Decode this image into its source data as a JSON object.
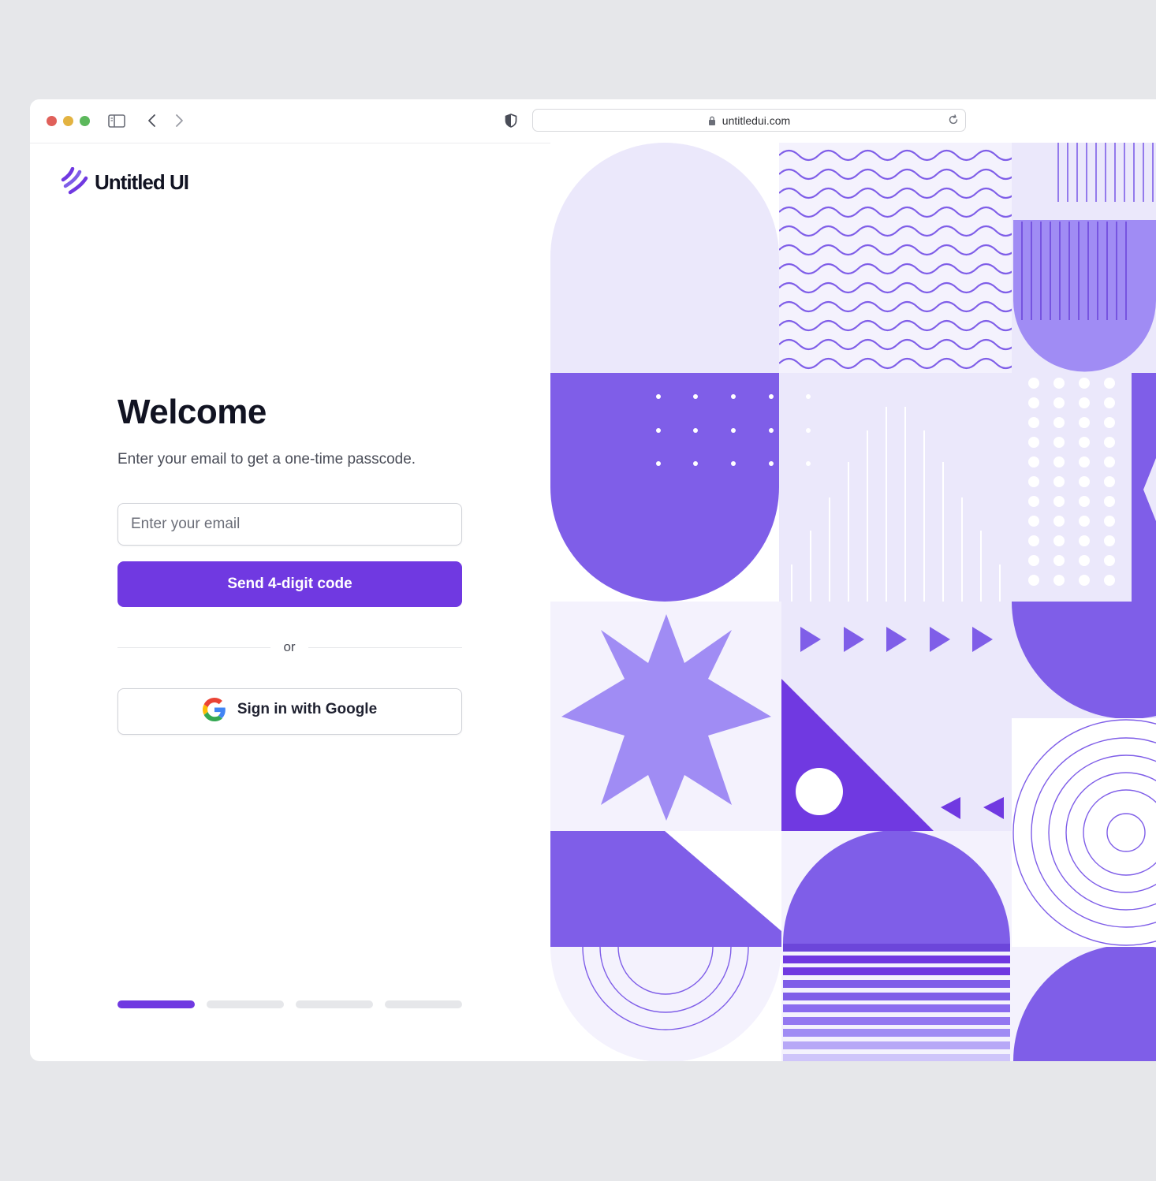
{
  "browser": {
    "url": "untitledui.com",
    "traffic_lights": [
      "close",
      "minimize",
      "zoom"
    ]
  },
  "brand": {
    "name": "Untitled UI",
    "accent": "#7039e1"
  },
  "login": {
    "title": "Welcome",
    "subtitle": "Enter your email to get a one-time passcode.",
    "email_placeholder": "Enter your email",
    "email_value": "",
    "send_button": "Send 4-digit code",
    "divider_text": "or",
    "google_button": "Sign in with Google"
  },
  "onboarding_progress": {
    "total_steps": 4,
    "current_step": 1
  },
  "colors": {
    "accent": "#7039e1",
    "violet_mid": "#7f5ee8",
    "violet_light": "#a08cf4",
    "lavender": "#ebe8fb",
    "lavender_pale": "#f4f2fd"
  }
}
